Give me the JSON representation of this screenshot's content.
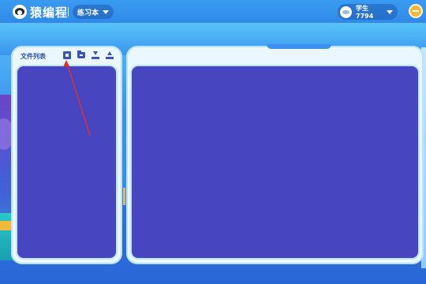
{
  "header": {
    "logo_text": "猿编程",
    "notebook_label": "练习本",
    "user_name": "学生7794"
  },
  "file_panel": {
    "title": "文件列表",
    "toolbar_icons": [
      "new-file-icon",
      "new-folder-icon",
      "upload-icon",
      "export-icon"
    ]
  },
  "colors": {
    "accent": "#4745c0",
    "topbar": "#2f8ae8",
    "panel_bg": "#eaf7ff",
    "minimize": "#f7b83a",
    "annotation": "#e0302a"
  }
}
